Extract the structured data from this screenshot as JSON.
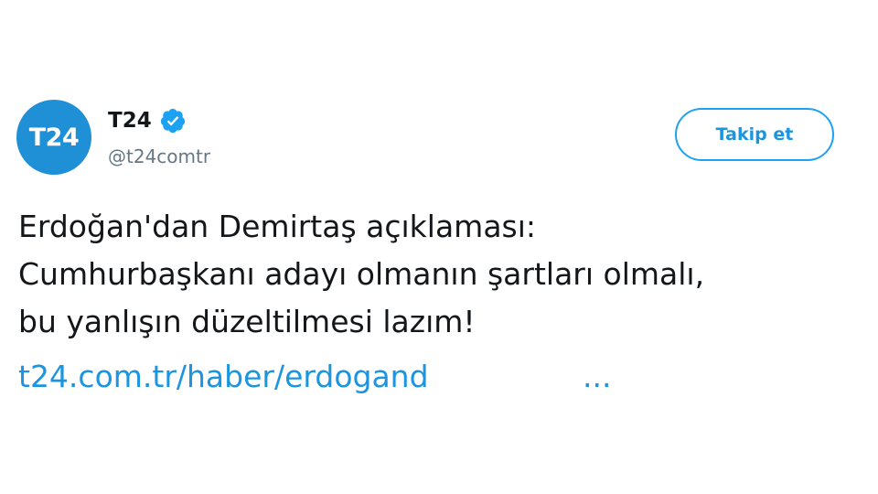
{
  "author": {
    "avatar_text": "T24",
    "display_name": "T24",
    "handle": "@t24comtr",
    "verified": true,
    "avatar_color": "#1f8fd6"
  },
  "follow_button": {
    "label": "Takip et"
  },
  "tweet": {
    "lines": [
      "Erdoğan'dan Demirtaş açıklaması:",
      "Cumhurbaşkanı adayı olmanın şartları olmalı,",
      "bu yanlışın düzeltilmesi lazım!"
    ],
    "link_text": "t24.com.tr/haber/erdogand",
    "link_ellipsis": "..."
  },
  "colors": {
    "accent": "#1da1f2",
    "link": "#1b95e0",
    "text": "#14171a",
    "secondary_text": "#657786"
  }
}
